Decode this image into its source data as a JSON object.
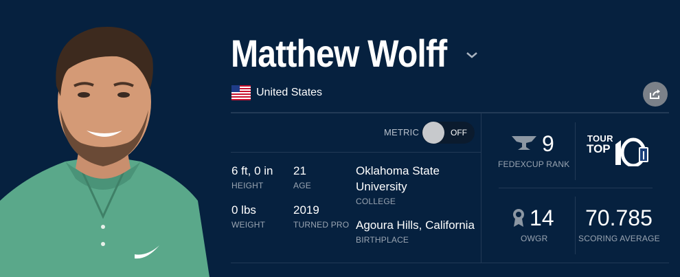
{
  "player": {
    "name": "Matthew Wolff",
    "country": "United States"
  },
  "toggle": {
    "metric_label": "METRIC",
    "state": "OFF"
  },
  "bio": {
    "height": {
      "value": "6  ft, 0  in",
      "label": "HEIGHT"
    },
    "age": {
      "value": "21",
      "label": "AGE"
    },
    "college": {
      "value_line1": "Oklahoma State",
      "value_line2": "University",
      "label": "COLLEGE"
    },
    "weight": {
      "value": "0 lbs",
      "label": "WEIGHT"
    },
    "turned_pro": {
      "value": "2019",
      "label": "TURNED PRO"
    },
    "birthplace": {
      "value": "Agoura Hills, California",
      "label": "BIRTHPLACE"
    }
  },
  "rankings": {
    "fedexcup": {
      "value": "9",
      "label": "FEDEXCUP RANK"
    },
    "tour_top10": {
      "line1": "TOUR",
      "line2": "TOP"
    },
    "owgr": {
      "value": "14",
      "label": "OWGR"
    },
    "scoring_average": {
      "value": "70.785",
      "label": "SCORING AVERAGE"
    }
  },
  "icons": {
    "expand": "chevron-down-icon",
    "share": "share-icon",
    "flag": "us-flag-icon",
    "fedex_trophy": "trophy-icon",
    "owgr": "ribbon-award-icon"
  },
  "colors": {
    "background": "#06213f",
    "divider": "#223a56",
    "label": "#9aa5b2",
    "share_button": "#7b8189"
  }
}
